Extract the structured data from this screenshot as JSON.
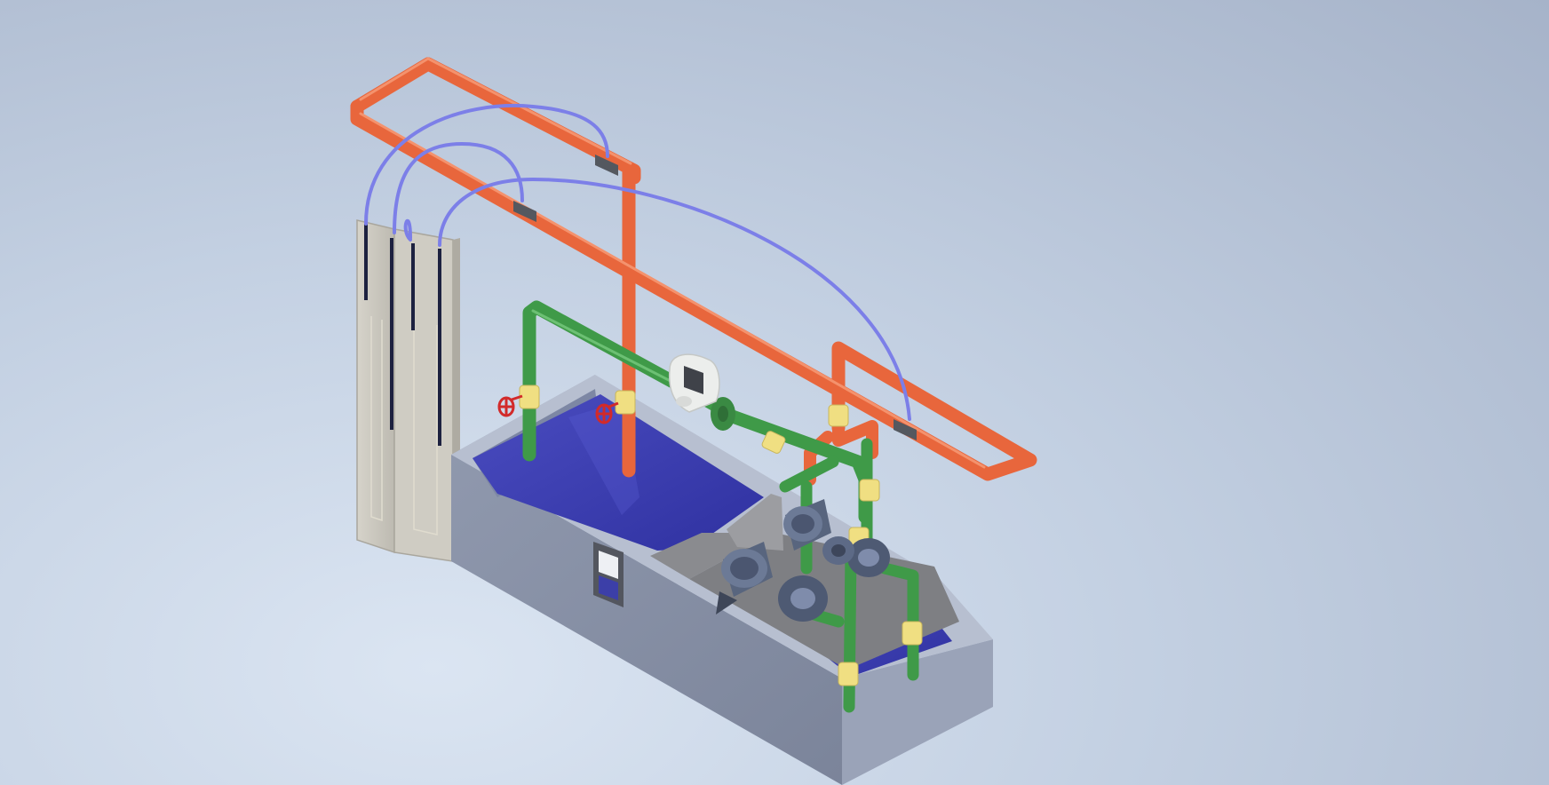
{
  "viewport": {
    "background_colors": [
      "#dbe5f2",
      "#c3d0e2",
      "#a6b3c9"
    ]
  },
  "scene": {
    "subject": "pump-test-rig",
    "icons": [
      "manometer-board-icon",
      "water-tank-icon",
      "pump-icon",
      "flow-meter-icon",
      "gate-valve-icon",
      "ball-valve-icon",
      "hand-wheel-icon",
      "sight-window-icon"
    ],
    "colors": {
      "orange_pipe": "#e8663c",
      "green_pipe": "#3f9a48",
      "pressure_tube": "#7c7fe8",
      "yellow_valve": "#f0df82",
      "red_wheel": "#d22a2a",
      "tank_wall": "#8f98ad",
      "water": "#3d3fb0",
      "manometer_board": "#c9c6bd",
      "pump_body": "#58657e"
    }
  }
}
